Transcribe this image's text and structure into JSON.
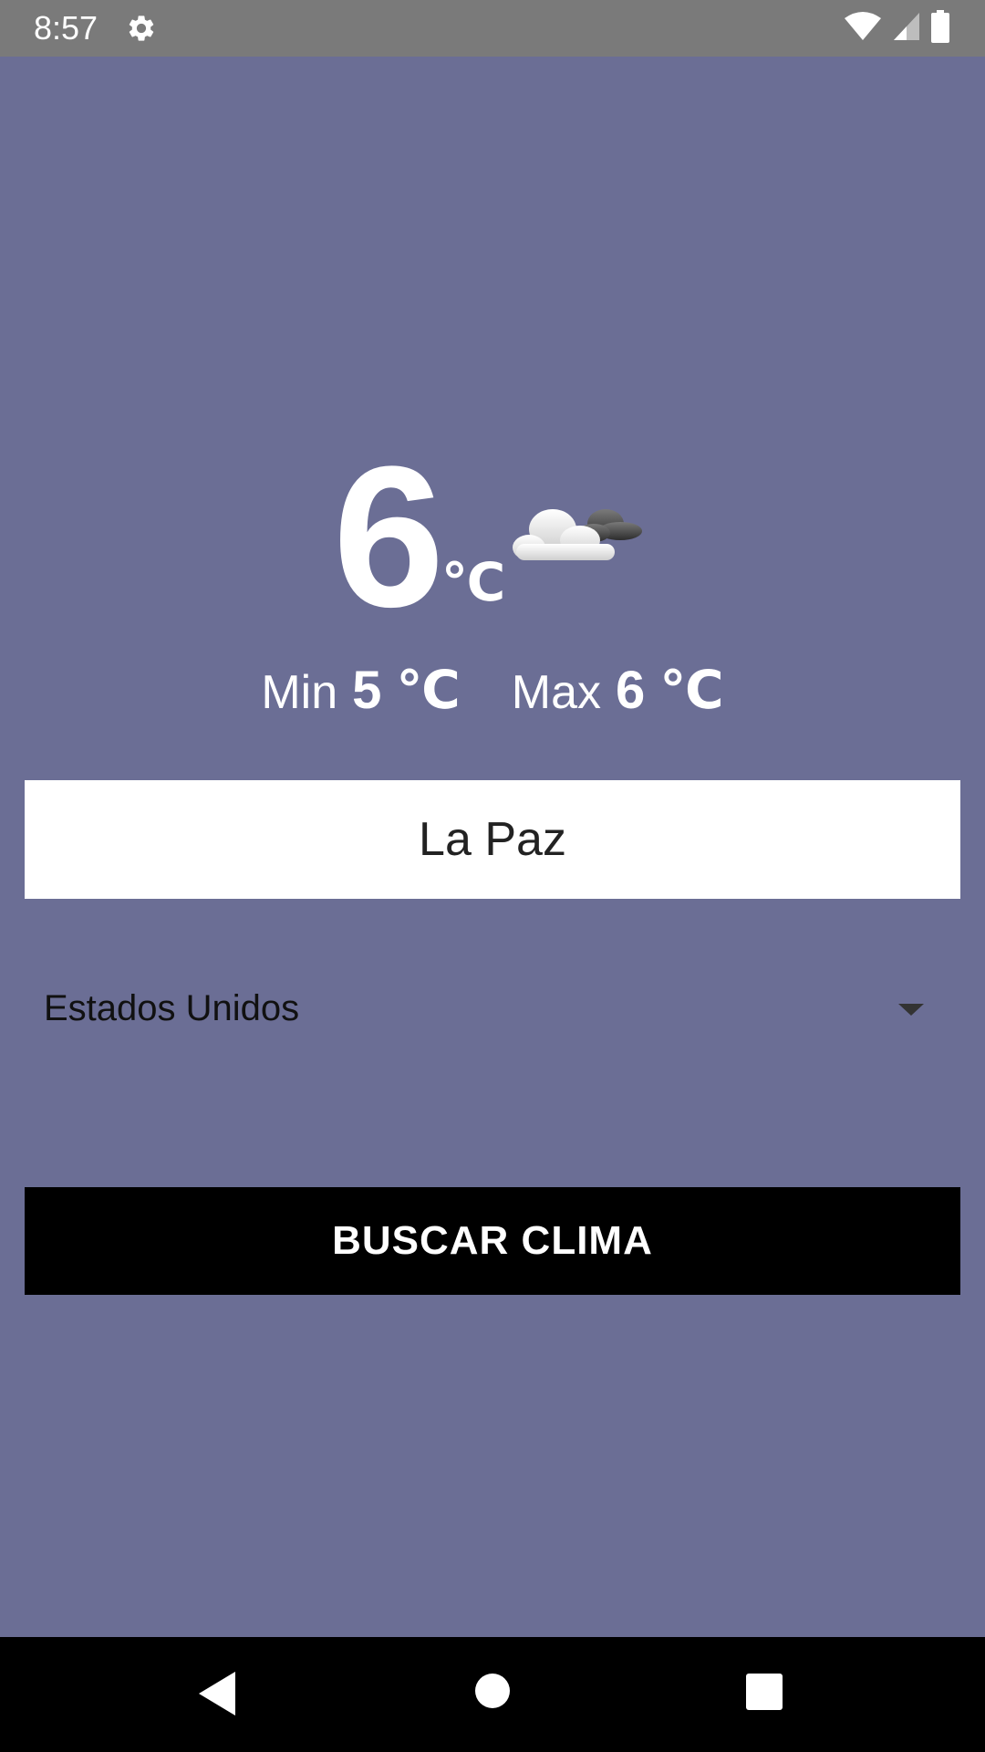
{
  "status_bar": {
    "time": "8:57",
    "icons": [
      "gear-icon",
      "wifi-icon",
      "signal-icon",
      "battery-icon"
    ]
  },
  "weather": {
    "temperature": "6",
    "unit": "℃",
    "icon": "cloudy-icon",
    "min_label": "Min",
    "min_value": "5 ℃",
    "max_label": "Max",
    "max_value": "6 ℃"
  },
  "form": {
    "city_value": "La Paz",
    "country_selected": "Estados Unidos",
    "search_button_label": "BUSCAR CLIMA"
  },
  "nav_bar": {
    "icons": [
      "back-icon",
      "home-icon",
      "recents-icon"
    ]
  },
  "colors": {
    "background": "#6b6e95",
    "status_bar": "#7a7a7a",
    "button": "#000000",
    "text_light": "#ffffff"
  }
}
